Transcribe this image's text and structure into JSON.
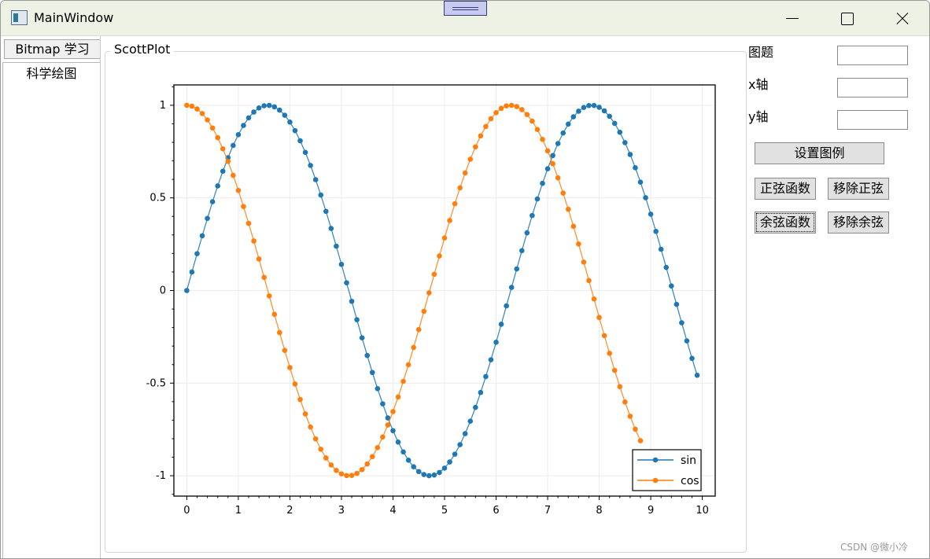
{
  "window": {
    "title": "MainWindow"
  },
  "tabs": [
    {
      "label": "Bitmap 学习"
    },
    {
      "label": "科学绘图"
    }
  ],
  "group": {
    "label": "ScottPlot"
  },
  "sidebar": {
    "title_label": "图题",
    "xaxis_label": "x轴",
    "yaxis_label": "y轴",
    "title_value": "",
    "xaxis_value": "",
    "yaxis_value": "",
    "set_legend_button": "设置图例",
    "sine_button": "正弦函数",
    "remove_sine_button": "移除正弦",
    "cosine_button": "余弦函数",
    "remove_cosine_button": "移除余弦"
  },
  "watermark": "CSDN @微小冷",
  "chart_data": {
    "type": "line",
    "x": {
      "start": 0,
      "end": 9.9,
      "step": 0.1
    },
    "series": [
      {
        "name": "sin",
        "function": "sin",
        "color": "#1f77b4"
      },
      {
        "name": "cos",
        "function": "cos",
        "color": "#ff7f0e",
        "visible_until_x": 8.8
      }
    ],
    "xticks": [
      "0",
      "1",
      "2",
      "3",
      "4",
      "5",
      "6",
      "7",
      "8",
      "9",
      "10"
    ],
    "yticks": [
      "1",
      "0.5",
      "0",
      "-0.5",
      "-1"
    ],
    "xlim": [
      -0.25,
      10.25
    ],
    "ylim": [
      -1.11,
      1.11
    ],
    "grid": true,
    "legend_position": "bottom-right"
  }
}
